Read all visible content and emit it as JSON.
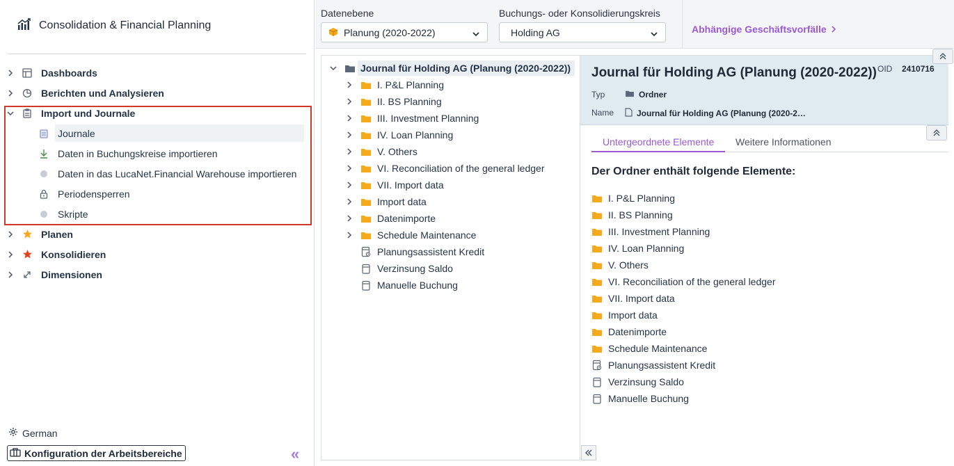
{
  "app": {
    "title": "Consolidation & Financial Planning"
  },
  "sidebar": {
    "items": [
      {
        "label": "Dashboards",
        "icon": "dashboard-icon"
      },
      {
        "label": "Berichten und Analysieren",
        "icon": "pie-chart-icon"
      },
      {
        "label": "Import und Journale",
        "icon": "clipboard-icon"
      },
      {
        "label": "Planen",
        "icon": "star-icon"
      },
      {
        "label": "Konsolidieren",
        "icon": "star-icon"
      },
      {
        "label": "Dimensionen",
        "icon": "expand-icon"
      }
    ],
    "subitems": [
      {
        "label": "Journale",
        "icon": "journal-icon"
      },
      {
        "label": "Daten in Buchungskreise importieren",
        "icon": "download-icon"
      },
      {
        "label": "Daten in das LucaNet.Financial Warehouse importieren",
        "icon": "dot-icon"
      },
      {
        "label": "Periodensperren",
        "icon": "lock-icon"
      },
      {
        "label": "Skripte",
        "icon": "dot-icon"
      }
    ],
    "language": "German",
    "config_button": "Konfiguration der Arbeitsbereiche",
    "collapse_glyph": "«"
  },
  "toolbar": {
    "datenebene_label": "Datenebene",
    "datenebene_value": "Planung (2020-2022)",
    "kreis_label": "Buchungs- oder Konsolidierungskreis",
    "kreis_value": "Holding AG",
    "dependent_link": "Abhängige Geschäftsvorfälle"
  },
  "tree": {
    "root": "Journal für Holding AG (Planung (2020-2022))",
    "children": [
      {
        "label": "I. P&L Planning",
        "type": "folder"
      },
      {
        "label": "II. BS Planning",
        "type": "folder"
      },
      {
        "label": "III. Investment Planning",
        "type": "folder"
      },
      {
        "label": "IV. Loan Planning",
        "type": "folder"
      },
      {
        "label": "V. Others",
        "type": "folder"
      },
      {
        "label": "VI. Reconciliation of the general ledger",
        "type": "folder"
      },
      {
        "label": "VII. Import data",
        "type": "folder"
      },
      {
        "label": "Import data",
        "type": "folder"
      },
      {
        "label": "Datenimporte",
        "type": "folder"
      },
      {
        "label": "Schedule Maintenance",
        "type": "folder"
      },
      {
        "label": "Planungsassistent Kredit",
        "type": "assistant"
      },
      {
        "label": "Verzinsung Saldo",
        "type": "journal"
      },
      {
        "label": "Manuelle Buchung",
        "type": "journal"
      }
    ]
  },
  "detail": {
    "title": "Journal für Holding AG (Planung (2020-2022))",
    "oid_label": "OID",
    "oid_value": "2410716",
    "typ_label": "Typ",
    "typ_value": "Ordner",
    "name_label": "Name",
    "name_value": "Journal für Holding AG (Planung (2020-2…",
    "tabs": [
      "Untergeordnete Elemente",
      "Weitere Informationen"
    ],
    "section_title": "Der Ordner enthält folgende Elemente:"
  },
  "colors": {
    "accent": "#9b59d0",
    "folder": "#f5a91b",
    "highlight_box": "#d03a2b"
  }
}
